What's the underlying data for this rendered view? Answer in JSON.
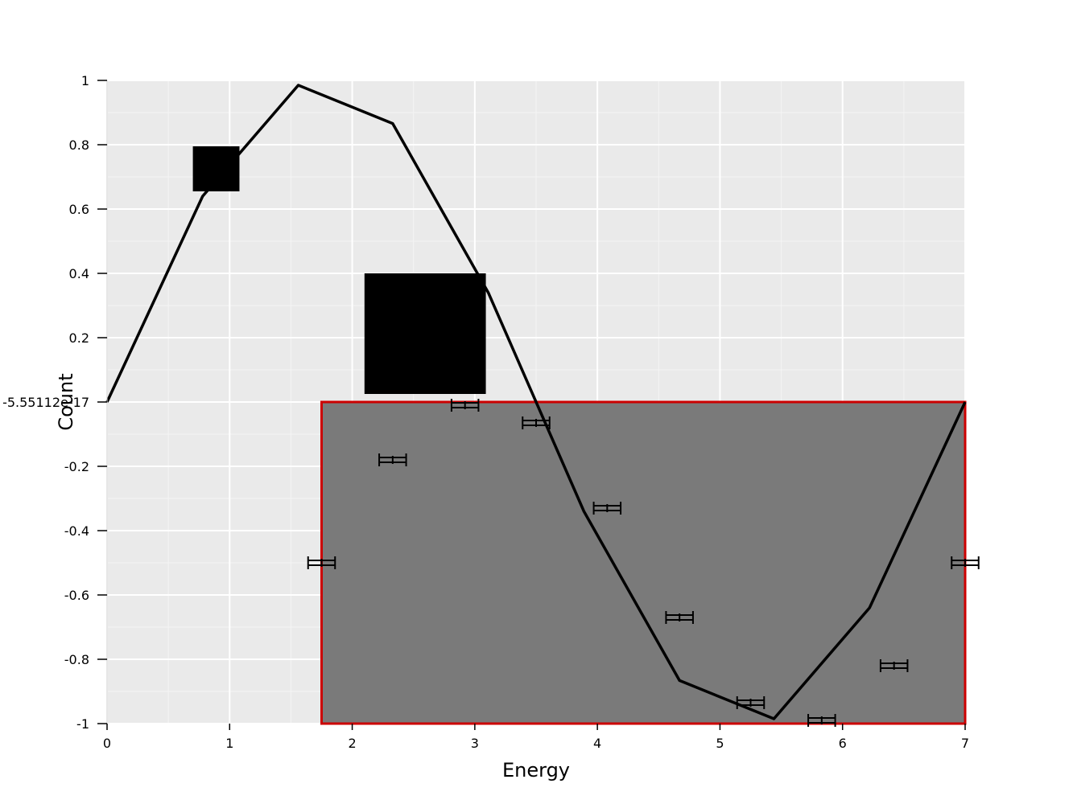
{
  "chart_data": {
    "type": "line",
    "xlabel": "Energy",
    "ylabel": "Count",
    "xlim": [
      0,
      7
    ],
    "ylim": [
      -1,
      1
    ],
    "x_ticks": [
      0,
      1,
      2,
      3,
      4,
      5,
      6,
      7
    ],
    "x_tick_labels": [
      "0",
      "1",
      "2",
      "3",
      "4",
      "5",
      "6",
      "7"
    ],
    "y_ticks": [
      -1,
      -0.8,
      -0.6,
      -0.4,
      -0.2,
      0,
      0.2,
      0.4,
      0.6,
      0.8,
      1
    ],
    "y_tick_labels": [
      "-1",
      "-0.8",
      "-0.6",
      "-0.4",
      "-0.2",
      "-5.55112e-17",
      "0.2",
      "0.4",
      "0.6",
      "0.8",
      "1"
    ],
    "grid": true,
    "background": "#eaeaea",
    "series": [
      {
        "x": [
          0,
          0.78,
          1.56,
          2.33,
          3.11,
          3.89,
          4.67,
          5.44,
          6.22,
          7.0
        ],
        "y": [
          0,
          0.64,
          0.985,
          0.866,
          0.34,
          -0.34,
          -0.866,
          -0.985,
          -0.64,
          0
        ],
        "color": "#000000"
      }
    ],
    "error_points": [
      {
        "x": 1.75,
        "y": -0.5,
        "xerr": 0.11
      },
      {
        "x": 2.33,
        "y": -0.18,
        "xerr": 0.11
      },
      {
        "x": 2.92,
        "y": -0.01,
        "xerr": 0.11
      },
      {
        "x": 3.5,
        "y": -0.065,
        "xerr": 0.11
      },
      {
        "x": 4.08,
        "y": -0.33,
        "xerr": 0.11
      },
      {
        "x": 4.67,
        "y": -0.67,
        "xerr": 0.11
      },
      {
        "x": 5.25,
        "y": -0.935,
        "xerr": 0.11
      },
      {
        "x": 5.83,
        "y": -0.99,
        "xerr": 0.11
      },
      {
        "x": 6.42,
        "y": -0.82,
        "xerr": 0.11
      },
      {
        "x": 7.0,
        "y": -0.5,
        "xerr": 0.11
      }
    ],
    "black_boxes": [
      {
        "x0": 0.7,
        "x1": 1.08,
        "y0": 0.655,
        "y1": 0.795
      },
      {
        "x0": 2.1,
        "x1": 3.09,
        "y0": 0.025,
        "y1": 0.4
      }
    ],
    "highlight_rect": {
      "x0": 1.75,
      "x1": 7.0,
      "y0": -1,
      "y1": 0,
      "fill": "#777777",
      "stroke": "#cc0000"
    }
  }
}
